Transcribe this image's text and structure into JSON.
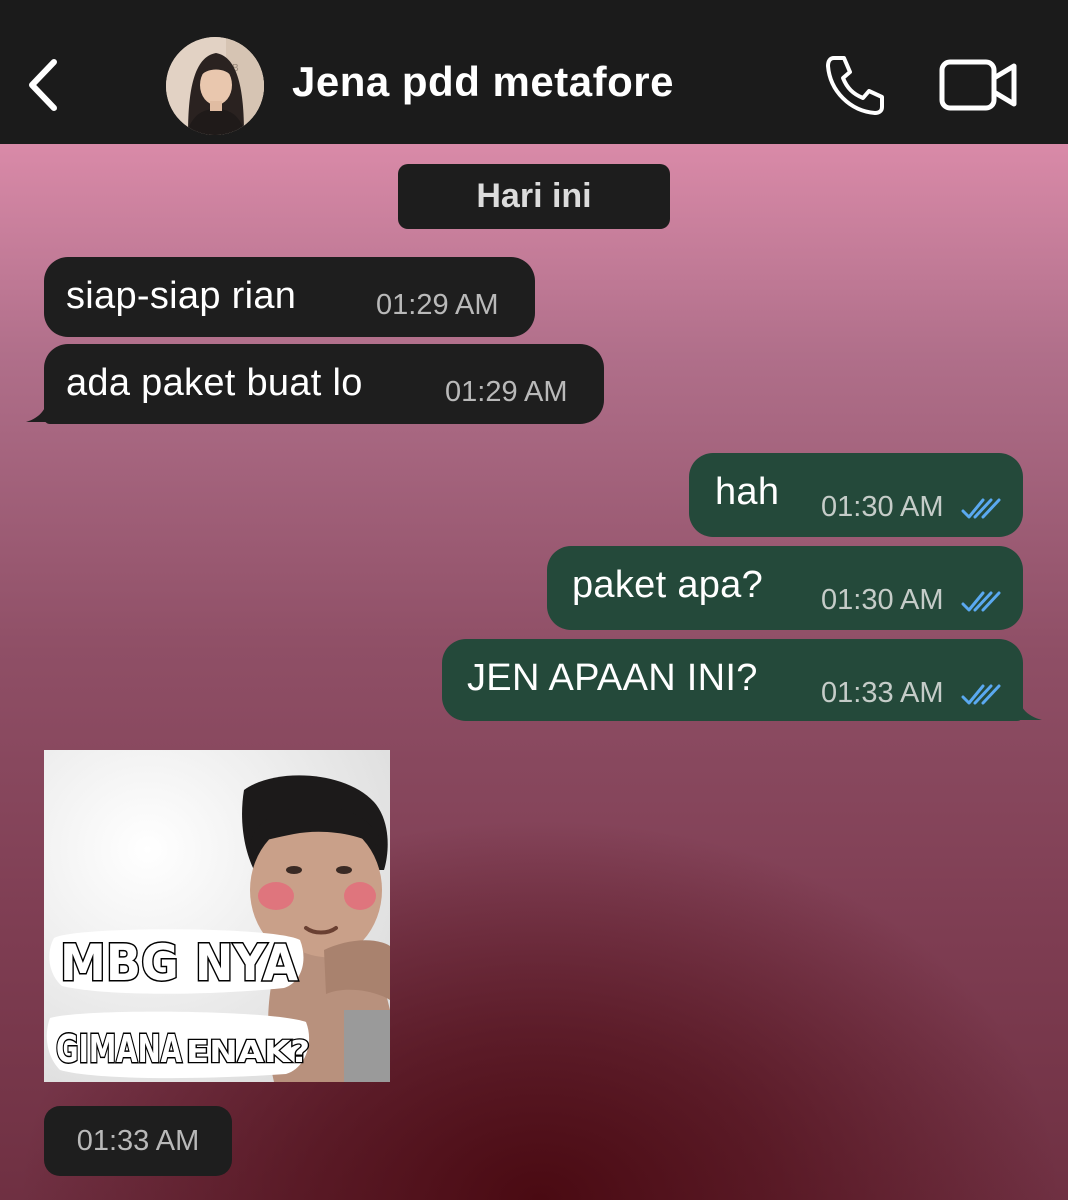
{
  "header": {
    "back_icon": "chevron-left-icon",
    "contact_name": "Jena pdd metafore",
    "call_icon": "phone-icon",
    "video_icon": "video-camera-icon",
    "background_color": "#1b1b1b"
  },
  "chat": {
    "date_label": "Hari ini",
    "messages": [
      {
        "direction": "incoming",
        "text": "siap-siap rian",
        "time": "01:29 AM"
      },
      {
        "direction": "incoming",
        "text": "ada paket buat lo",
        "time": "01:29 AM"
      },
      {
        "direction": "outgoing",
        "text": "hah",
        "time": "01:30 AM",
        "status": "read"
      },
      {
        "direction": "outgoing",
        "text": "paket apa?",
        "time": "01:30 AM",
        "status": "read"
      },
      {
        "direction": "outgoing",
        "text": "JEN APAAN INI?",
        "time": "01:33 AM",
        "status": "read"
      }
    ],
    "sticker": {
      "caption_line1": "MBG NYA",
      "caption_line2_a": "GIMANA",
      "caption_line2_b": "ENAK?",
      "time": "01:33 AM"
    },
    "colors": {
      "incoming_bubble": "#1e1e1e",
      "outgoing_bubble": "#24493a",
      "read_ticks": "#5aa9f0"
    }
  }
}
